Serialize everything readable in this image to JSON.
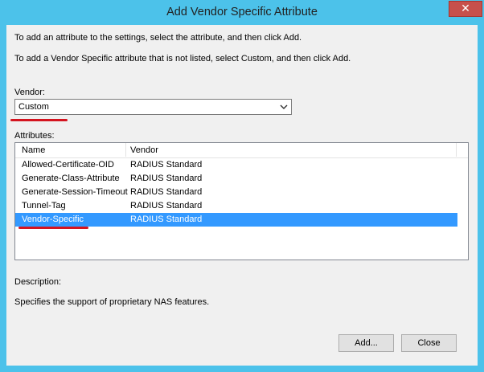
{
  "window": {
    "title": "Add Vendor Specific Attribute",
    "close_glyph": "✕"
  },
  "instructions": {
    "line1": "To add an attribute to the settings, select the attribute, and then click Add.",
    "line2": "To add a Vendor Specific attribute that is not listed, select Custom, and then click Add."
  },
  "vendor": {
    "label": "Vendor:",
    "selected": "Custom",
    "dropdown_icon": "chevron-down-icon"
  },
  "attributes": {
    "label": "Attributes:",
    "columns": [
      "Name",
      "Vendor"
    ],
    "rows": [
      {
        "name": "Allowed-Certificate-OID",
        "vendor": "RADIUS Standard",
        "selected": false
      },
      {
        "name": "Generate-Class-Attribute",
        "vendor": "RADIUS Standard",
        "selected": false
      },
      {
        "name": "Generate-Session-Timeout",
        "vendor": "RADIUS Standard",
        "selected": false
      },
      {
        "name": "Tunnel-Tag",
        "vendor": "RADIUS Standard",
        "selected": false
      },
      {
        "name": "Vendor-Specific",
        "vendor": "RADIUS Standard",
        "selected": true
      }
    ]
  },
  "description": {
    "label": "Description:",
    "text": "Specifies the support of proprietary NAS features."
  },
  "buttons": {
    "add": "Add...",
    "close": "Close"
  },
  "colors": {
    "title_bar": "#4cc2ea",
    "selection": "#3399ff",
    "annotation_underline": "#d4141f",
    "close_button": "#c7504b"
  }
}
